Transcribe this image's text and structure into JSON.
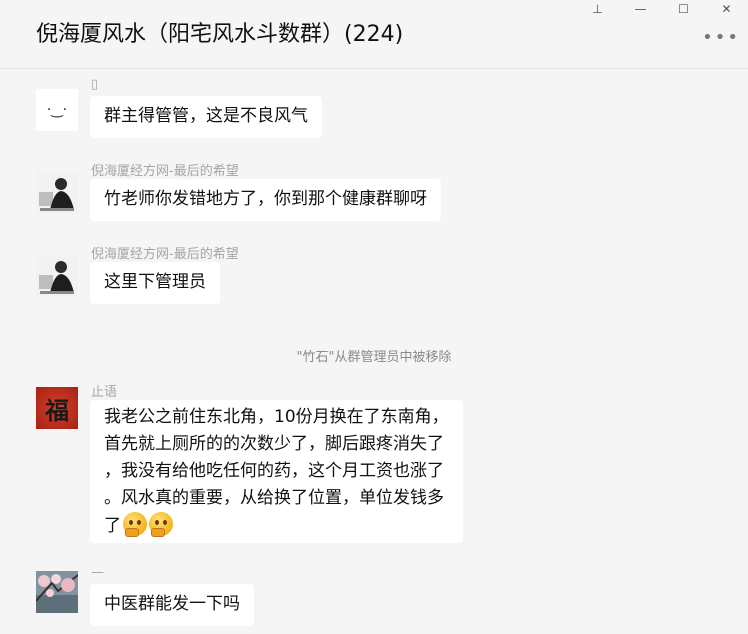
{
  "window": {
    "title": "倪海厦风水（阳宅风水斗数群）(224)",
    "controls": {
      "pin": "⊥",
      "minimize": "—",
      "maximize": "☐",
      "close": "✕"
    },
    "more_icon": "•••"
  },
  "messages": [
    {
      "sender": "▯",
      "avatar": "smiley-icon",
      "lines": [
        "群主得管管，这是不良风气"
      ]
    },
    {
      "sender": "倪海厦经方网-最后的希望",
      "avatar": "photo-avatar",
      "lines": [
        "竹老师你发错地方了，你到那个健康群聊呀"
      ]
    },
    {
      "sender": "倪海厦经方网-最后的希望",
      "avatar": "photo-avatar",
      "lines": [
        "这里下管理员"
      ]
    },
    {
      "sender": "止语",
      "avatar": "fu-character-avatar",
      "lines": [
        "我老公之前住东北角，10份月换在了东南角，",
        "首先就上厕所的的次数少了，脚后跟疼消失了",
        "，我没有给他吃任何的药，这个月工资也涨了",
        "。风水真的重要，从给换了位置，单位发钱多",
        "了"
      ],
      "trailing_emoji": "thinking-face-icon"
    },
    {
      "sender": "—",
      "avatar": "cherry-blossom-avatar",
      "lines": [
        "中医群能发一下吗"
      ]
    }
  ],
  "system_notice": "\"竹石\"从群管理员中被移除",
  "avatar_text": {
    "fu": "福",
    "smiley": "·‿·"
  }
}
